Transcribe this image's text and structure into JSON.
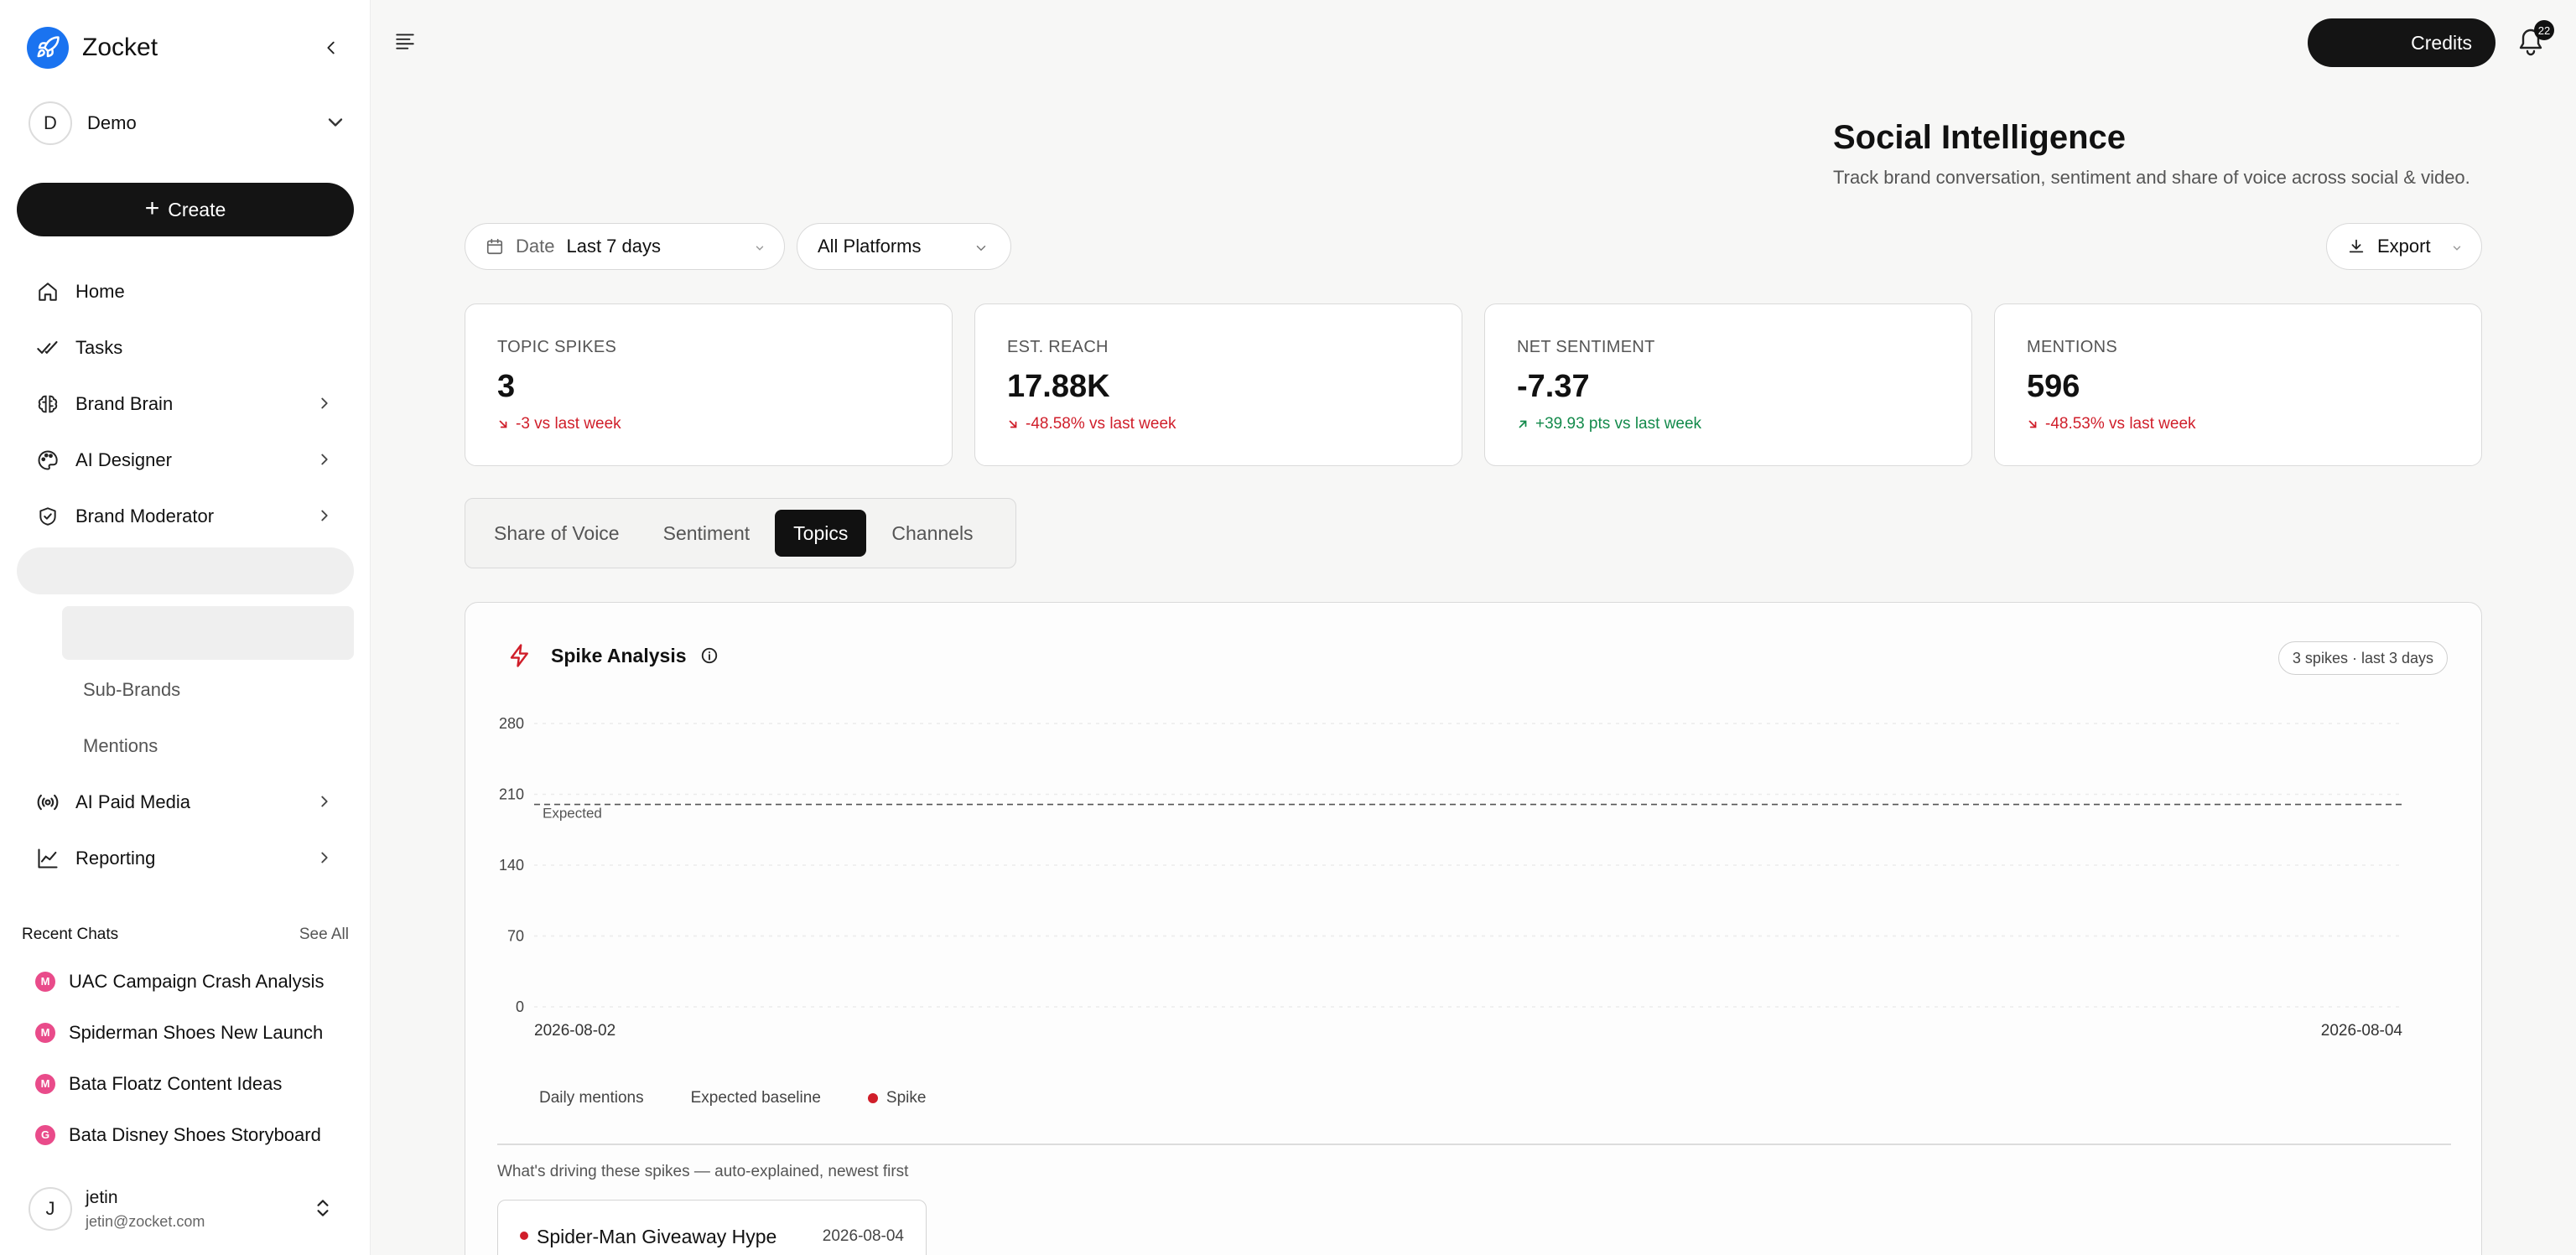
{
  "app": {
    "name": "Zocket"
  },
  "workspace": {
    "initial": "D",
    "name": "Demo"
  },
  "sidebar": {
    "create_label": "Create",
    "items": [
      {
        "label": "Home",
        "icon": "home-icon"
      },
      {
        "label": "Tasks",
        "icon": "tasks-icon"
      },
      {
        "label": "Brand Brain",
        "icon": "brain-icon"
      },
      {
        "label": "AI Designer",
        "icon": "palette-icon"
      },
      {
        "label": "Brand Moderator",
        "icon": "shield-icon"
      }
    ],
    "sub_items": [
      {
        "label": "Sub-Brands"
      },
      {
        "label": "Mentions"
      }
    ],
    "items_after": [
      {
        "label": "AI Paid Media",
        "icon": "broadcast-icon"
      },
      {
        "label": "Reporting",
        "icon": "chart-line-icon"
      }
    ],
    "recent_title": "Recent Chats",
    "see_all": "See All",
    "recent": [
      {
        "initial": "M",
        "label": "UAC Campaign Crash Analysis"
      },
      {
        "initial": "M",
        "label": "Spiderman Shoes New Launch"
      },
      {
        "initial": "M",
        "label": "Bata Floatz Content Ideas"
      },
      {
        "initial": "G",
        "label": "Bata Disney Shoes Storyboard"
      }
    ]
  },
  "user": {
    "initial": "J",
    "name": "jetin",
    "email": "jetin@zocket.com"
  },
  "topbar": {
    "credits_label": "Credits",
    "notification_count": "22"
  },
  "header": {
    "title": "Social Intelligence",
    "subtitle": "Track brand conversation, sentiment and share of voice across social & video."
  },
  "filters": {
    "date_label": "Date",
    "date_value": "Last 7 days",
    "platform_value": "All Platforms",
    "export_label": "Export"
  },
  "kpis": [
    {
      "label": "TOPIC SPIKES",
      "value": "3",
      "delta": "-3 vs last week",
      "trend": "down"
    },
    {
      "label": "EST. REACH",
      "value": "17.88K",
      "delta": "-48.58% vs last week",
      "trend": "down"
    },
    {
      "label": "NET SENTIMENT",
      "value": "-7.37",
      "delta": "+39.93 pts vs last week",
      "trend": "up"
    },
    {
      "label": "MENTIONS",
      "value": "596",
      "delta": "-48.53% vs last week",
      "trend": "down"
    }
  ],
  "tabs": [
    {
      "label": "Share of Voice",
      "active": false
    },
    {
      "label": "Sentiment",
      "active": false
    },
    {
      "label": "Topics",
      "active": true
    },
    {
      "label": "Channels",
      "active": false
    }
  ],
  "spike_analysis": {
    "title": "Spike Analysis",
    "pill": "3 spikes · last 3 days",
    "drivers_note": "What's driving these spikes — auto-explained, newest first",
    "drivers": [
      {
        "title": "Spider-Man Giveaway Hype",
        "date": "2026-08-04"
      }
    ]
  },
  "colors": {
    "accent": "#1a73f0",
    "spike": "#d01e2a",
    "positive": "#138a4b",
    "dark": "#141414"
  },
  "chart_data": {
    "type": "line",
    "x": [
      "2026-08-02",
      "2026-08-04"
    ],
    "ylim": [
      0,
      280
    ],
    "yticks": [
      0,
      70,
      140,
      210,
      280
    ],
    "series": [
      {
        "name": "Daily mentions",
        "values": []
      },
      {
        "name": "Expected baseline",
        "values": [
          200,
          200
        ]
      }
    ],
    "annotations": [
      {
        "text": "Expected",
        "y": 200
      }
    ],
    "legend": [
      "Daily mentions",
      "Expected baseline",
      "Spike"
    ],
    "grid": true,
    "legend_position": "bottom"
  }
}
